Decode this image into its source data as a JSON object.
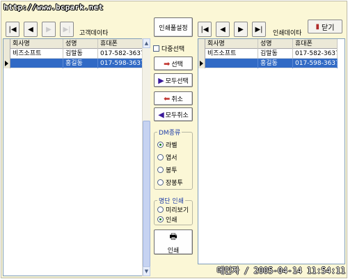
{
  "watermark_url": "http://www.bcpark.net",
  "left_panel": {
    "title": "고객데이타",
    "columns": [
      "회사명",
      "성명",
      "휴대폰"
    ],
    "rows": [
      {
        "company": "비즈소프트",
        "name": "김말동",
        "phone": "017-582-3637"
      },
      {
        "company": "",
        "name": "홍길동",
        "phone": "017-598-3637"
      }
    ]
  },
  "right_panel": {
    "title": "인쇄데이타",
    "close_label": "닫기",
    "columns": [
      "회사명",
      "성명",
      "휴대폰"
    ],
    "rows": [
      {
        "company": "비즈소프트",
        "name": "김말동",
        "phone": "017-582-3637"
      },
      {
        "company": "",
        "name": "홍길동",
        "phone": "017-598-3637"
      }
    ]
  },
  "middle": {
    "print_settings_label": "인쇄풀설정",
    "multi_select_label": "다중선택",
    "select_label": "선택",
    "select_all_label": "모두선택",
    "cancel_label": "취소",
    "cancel_all_label": "모두취소",
    "dm_group": {
      "title": "DM종류",
      "options": [
        "라벨",
        "엽서",
        "봉투",
        "장봉투"
      ],
      "selected": "라벨"
    },
    "print_group": {
      "title": "명단 인쇄",
      "options": [
        "미리보기",
        "인쇄"
      ],
      "selected": "인쇄"
    },
    "print_button_label": "인쇄"
  },
  "author_stamp": "메인자 / 2005-04-14 11:54:11",
  "colors": {
    "selection": "#316ac5",
    "window_bg": "#fbf7d6",
    "arrow_red": "#c0302a",
    "arrow_purple": "#3a1a9a"
  }
}
